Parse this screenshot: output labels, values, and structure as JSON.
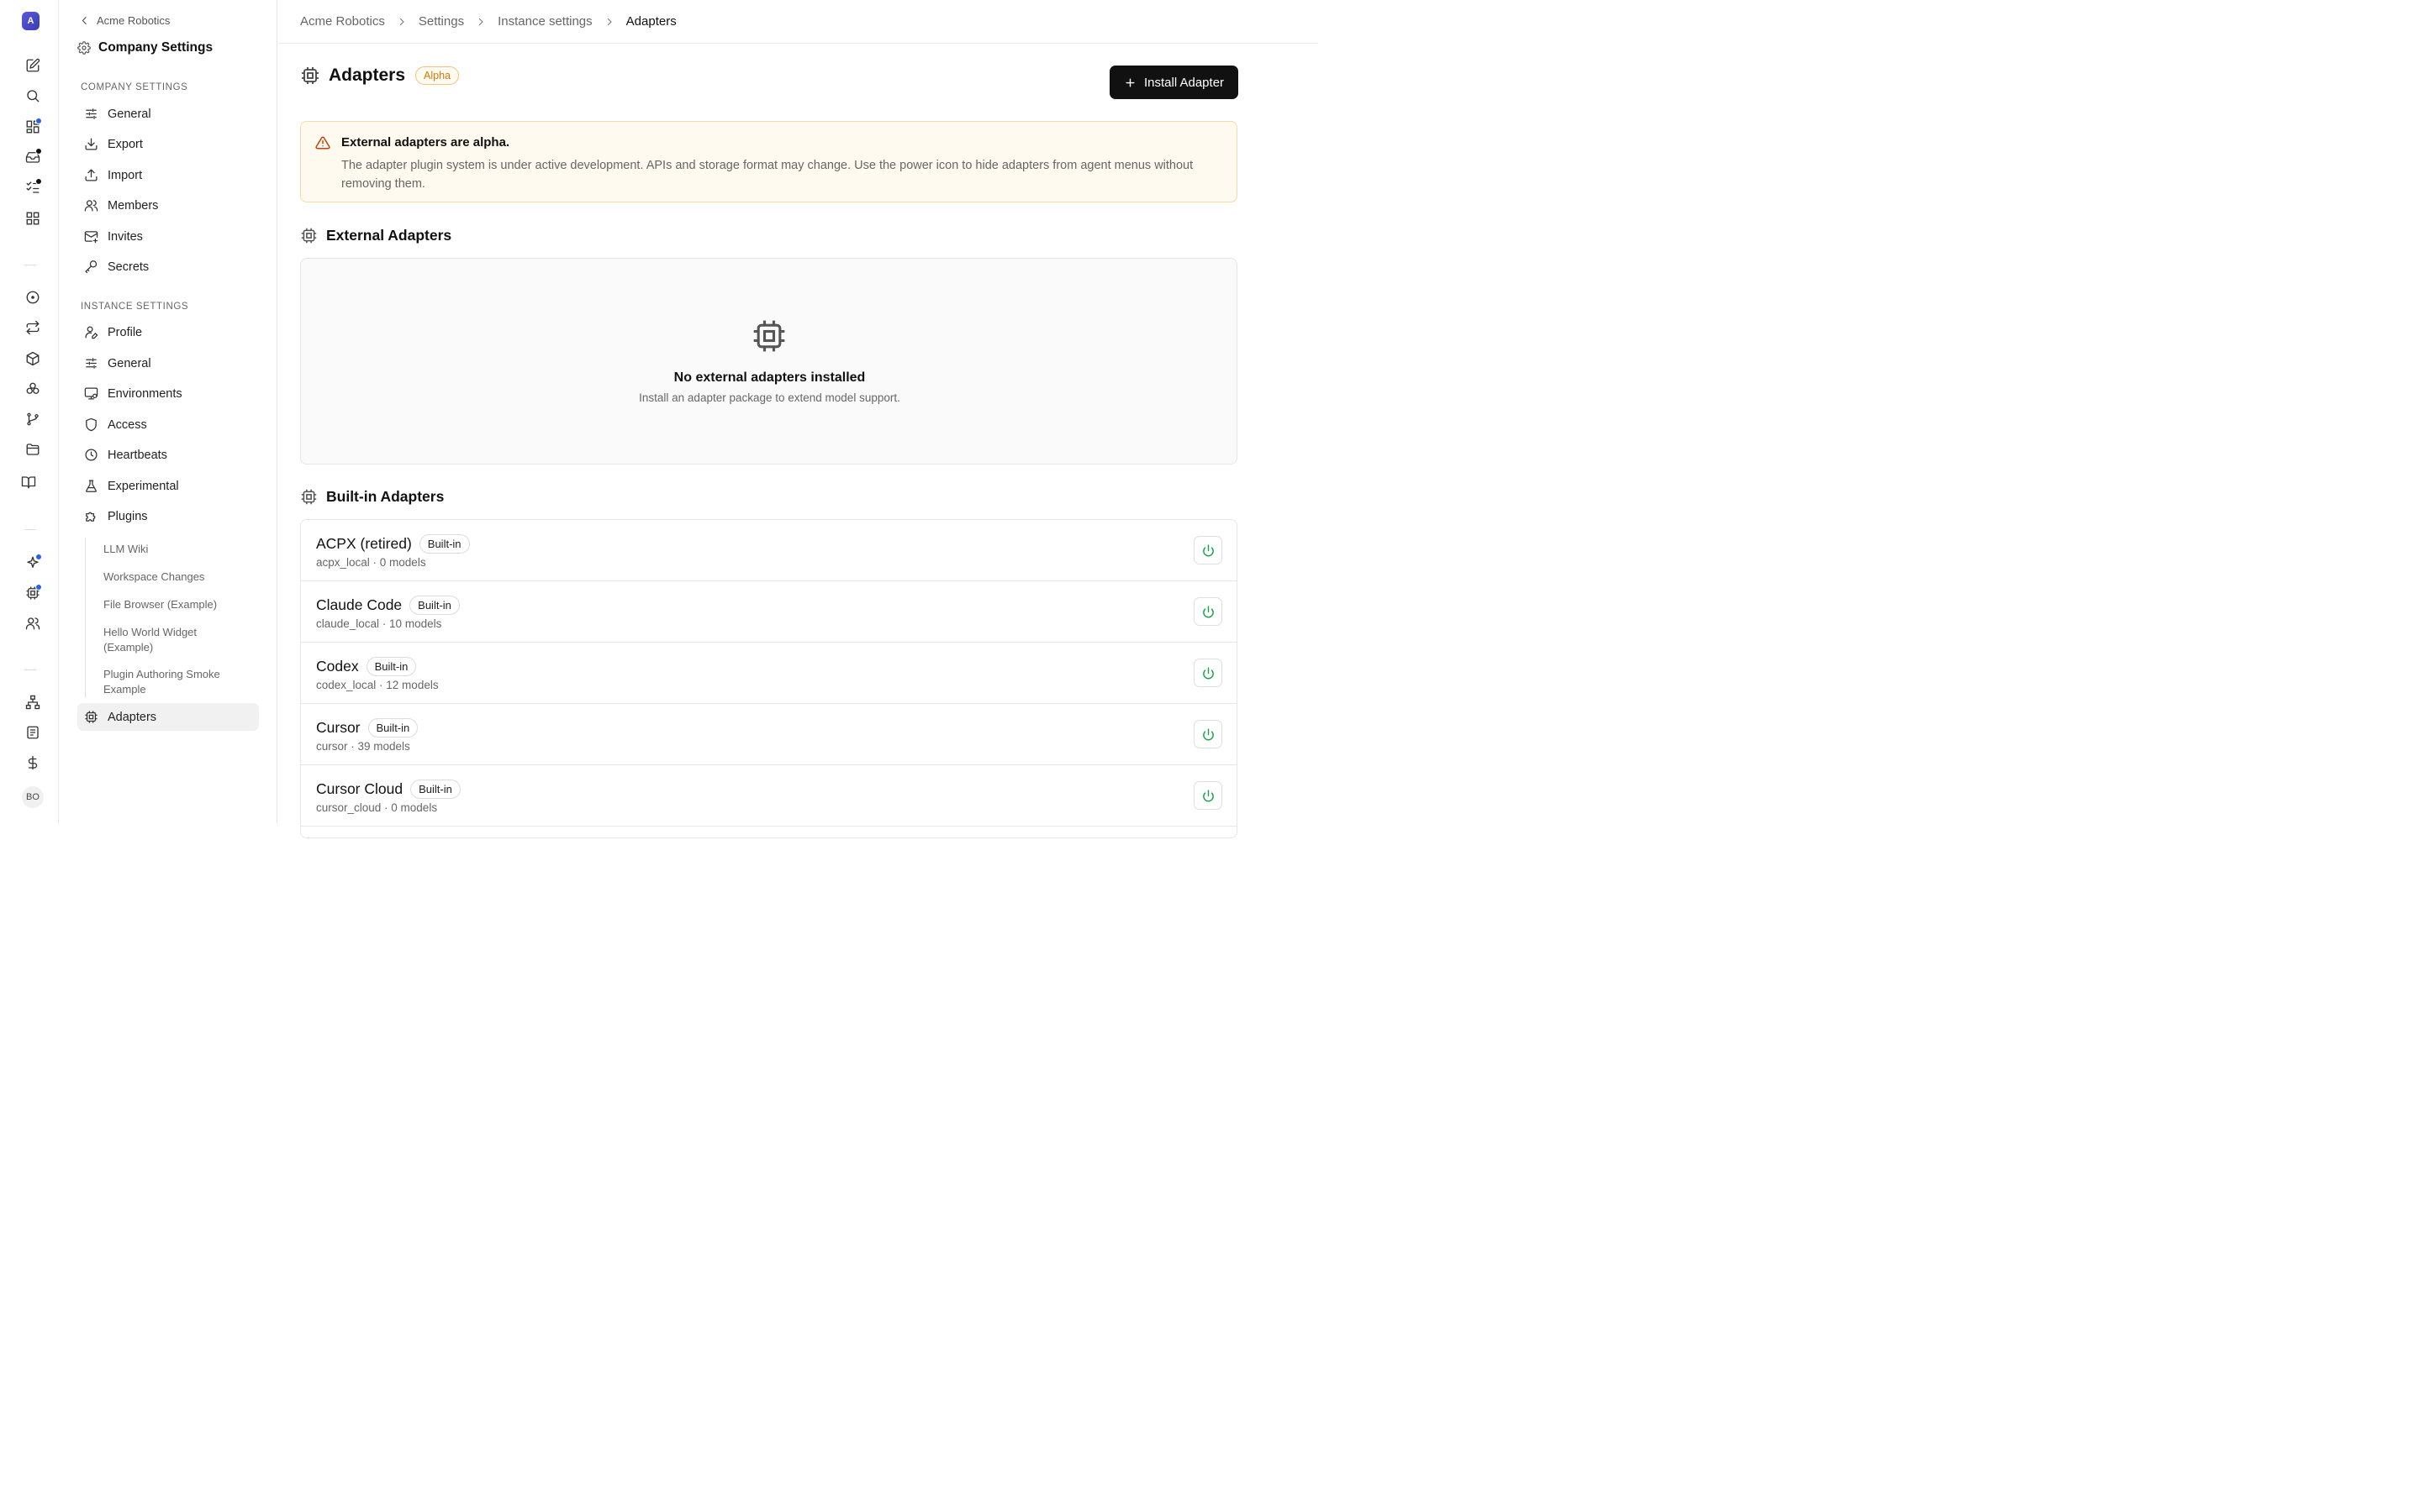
{
  "rail": {
    "logo_letter": "A",
    "avatar_initials": "BO",
    "icons": [
      "edit-icon",
      "search-icon",
      "dashboard-icon",
      "inbox-icon",
      "tasks-icon",
      "apps-icon",
      "target-icon",
      "swap-icon",
      "package-icon",
      "components-icon",
      "branch-icon",
      "folder-icon",
      "book-icon",
      "sparkle-icon",
      "chip-icon",
      "users-icon",
      "org-chart-icon",
      "document-icon",
      "dollar-icon"
    ]
  },
  "sidebar": {
    "back_label": "Acme Robotics",
    "title": "Company Settings",
    "company_section": "COMPANY SETTINGS",
    "company_items": [
      {
        "label": "General",
        "icon": "sliders-icon"
      },
      {
        "label": "Export",
        "icon": "download-icon"
      },
      {
        "label": "Import",
        "icon": "upload-icon"
      },
      {
        "label": "Members",
        "icon": "users-icon"
      },
      {
        "label": "Invites",
        "icon": "mail-plus-icon"
      },
      {
        "label": "Secrets",
        "icon": "key-icon"
      }
    ],
    "instance_section": "INSTANCE SETTINGS",
    "instance_items": [
      {
        "label": "Profile",
        "icon": "user-pen-icon"
      },
      {
        "label": "General",
        "icon": "sliders-icon"
      },
      {
        "label": "Environments",
        "icon": "monitor-icon"
      },
      {
        "label": "Access",
        "icon": "shield-icon"
      },
      {
        "label": "Heartbeats",
        "icon": "clock-icon"
      },
      {
        "label": "Experimental",
        "icon": "flask-icon"
      },
      {
        "label": "Plugins",
        "icon": "puzzle-icon"
      }
    ],
    "plugin_items": [
      "LLM Wiki",
      "Workspace Changes",
      "File Browser (Example)",
      "Hello World Widget (Example)",
      "Plugin Authoring Smoke Example"
    ],
    "active_item": {
      "label": "Adapters",
      "icon": "chip-icon"
    }
  },
  "breadcrumb": [
    "Acme Robotics",
    "Settings",
    "Instance settings",
    "Adapters"
  ],
  "header": {
    "title": "Adapters",
    "badge": "Alpha",
    "install_label": "Install Adapter"
  },
  "alert": {
    "title": "External adapters are alpha.",
    "body": "The adapter plugin system is under active development. APIs and storage format may change. Use the power icon to hide adapters from agent menus without removing them."
  },
  "external": {
    "heading": "External Adapters",
    "empty_title": "No external adapters installed",
    "empty_sub": "Install an adapter package to extend model support."
  },
  "builtin": {
    "heading": "Built-in Adapters",
    "badge": "Built-in",
    "adapters": [
      {
        "name": "ACPX (retired)",
        "meta": "acpx_local · 0 models"
      },
      {
        "name": "Claude Code",
        "meta": "claude_local · 10 models"
      },
      {
        "name": "Codex",
        "meta": "codex_local · 12 models"
      },
      {
        "name": "Cursor",
        "meta": "cursor · 39 models"
      },
      {
        "name": "Cursor Cloud",
        "meta": "cursor_cloud · 0 models"
      }
    ]
  },
  "colors": {
    "accent": "#111111",
    "alpha_text": "#d97706",
    "alert_bg": "#fffaf0",
    "power_green": "#16a34a",
    "notification_blue": "#2563eb"
  }
}
